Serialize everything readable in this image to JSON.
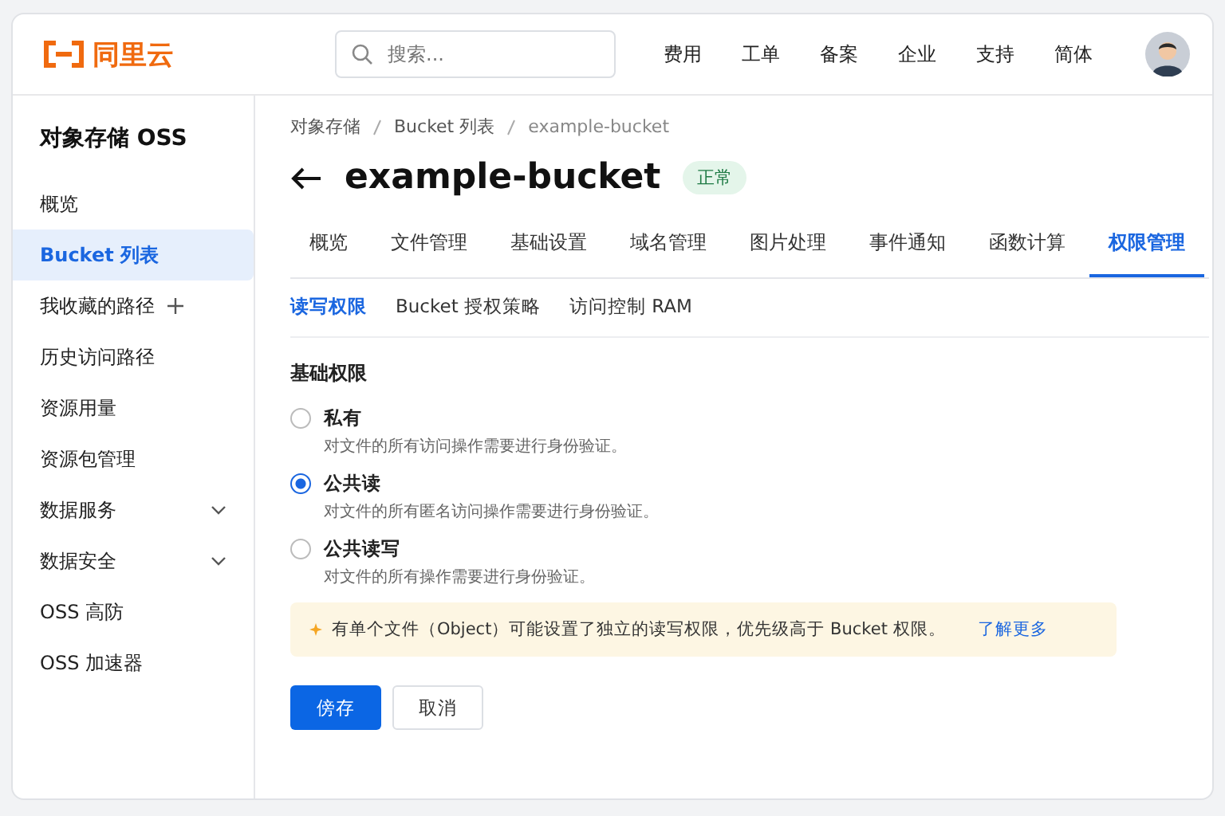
{
  "header": {
    "logo": "同里云",
    "search": {
      "placeholder": "搜索..."
    },
    "nav": [
      "费用",
      "工单",
      "备案",
      "企业",
      "支持",
      "简体"
    ]
  },
  "sidebar": {
    "title": "对象存储 OSS",
    "items": [
      {
        "label": "概览",
        "selected": false,
        "kind": "plain"
      },
      {
        "label": "Bucket 列表",
        "selected": true,
        "kind": "plain"
      },
      {
        "label": "我收藏的路径",
        "selected": false,
        "kind": "add"
      },
      {
        "label": "历史访问路径",
        "selected": false,
        "kind": "plain"
      },
      {
        "label": "资源用量",
        "selected": false,
        "kind": "plain"
      },
      {
        "label": "资源包管理",
        "selected": false,
        "kind": "plain"
      },
      {
        "label": "数据服务",
        "selected": false,
        "kind": "expand"
      },
      {
        "label": "数据安全",
        "selected": false,
        "kind": "expand"
      },
      {
        "label": "OSS 高防",
        "selected": false,
        "kind": "plain"
      },
      {
        "label": "OSS 加速器",
        "selected": false,
        "kind": "plain"
      }
    ]
  },
  "breadcrumb": [
    "对象存储",
    "Bucket 列表",
    "example-bucket"
  ],
  "page": {
    "title": "example-bucket",
    "status": "正常"
  },
  "tabs": [
    {
      "label": "概览",
      "selected": false
    },
    {
      "label": "文件管理",
      "selected": false
    },
    {
      "label": "基础设置",
      "selected": false
    },
    {
      "label": "域名管理",
      "selected": false
    },
    {
      "label": "图片处理",
      "selected": false
    },
    {
      "label": "事件通知",
      "selected": false
    },
    {
      "label": "函数计算",
      "selected": false
    },
    {
      "label": "权限管理",
      "selected": true
    }
  ],
  "subtabs": [
    {
      "label": "读写权限",
      "selected": true
    },
    {
      "label": "Bucket 授权策略",
      "selected": false
    },
    {
      "label": "访问控制 RAM",
      "selected": false
    }
  ],
  "section_title": "基础权限",
  "options": [
    {
      "label": "私有",
      "description": "对文件的所有访问操作需要进行身份验证。",
      "selected": false
    },
    {
      "label": "公共读",
      "description": "对文件的所有匿名访问操作需要进行身份验证。",
      "selected": true
    },
    {
      "label": "公共读写",
      "description": "对文件的所有操作需要进行身份验证。",
      "selected": false
    }
  ],
  "notice": {
    "text": "有单个文件（Object）可能设置了独立的读写权限，优先级高于 Bucket 权限。",
    "link": "了解更多"
  },
  "buttons": [
    {
      "label": "傍存",
      "kind": "primary"
    },
    {
      "label": "取消",
      "kind": "secondary"
    }
  ]
}
